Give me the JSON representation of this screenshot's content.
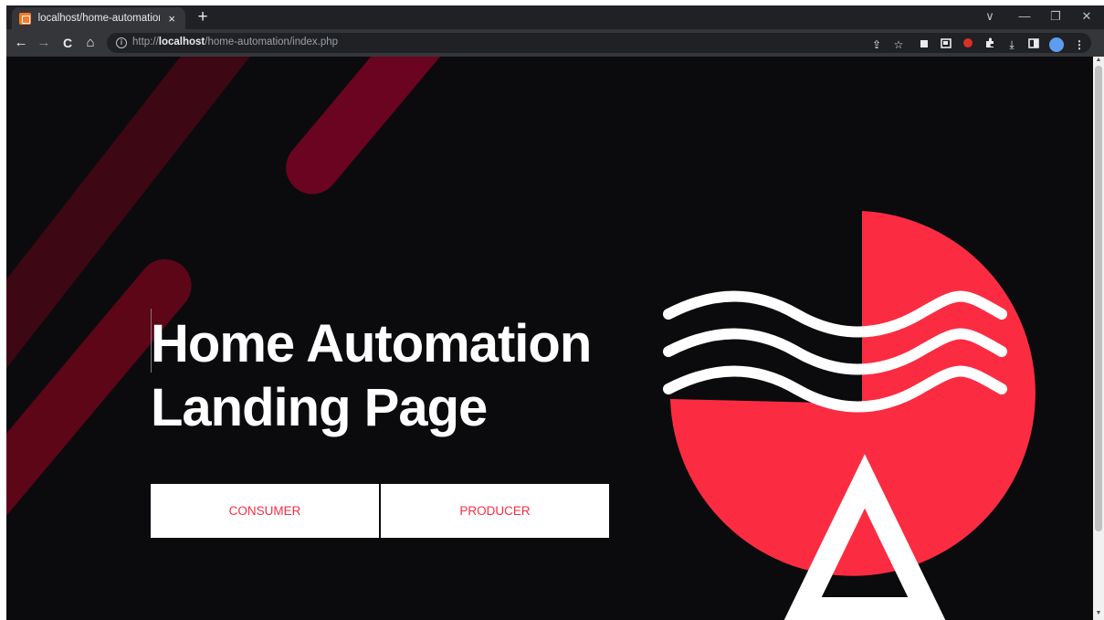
{
  "browser": {
    "tab_title": "localhost/home-automation/index.php",
    "tab_close": "×",
    "new_tab": "+",
    "url_scheme": "http://",
    "url_host": "localhost",
    "url_path": "/home-automation/index.php",
    "info": "i",
    "nav": {
      "back": "←",
      "forward": "→",
      "reload": "C",
      "home": "⌂"
    },
    "window": {
      "menu": "∨",
      "minimize": "—",
      "restore": "❐",
      "close": "✕"
    },
    "toolbar": {
      "share": "⇪",
      "star": "☆",
      "download": "⤓",
      "more": "⋮"
    }
  },
  "hero": {
    "title_line1": "Home Automation",
    "title_line2": "Landing Page",
    "consumer_label": "CONSUMER",
    "producer_label": "PRODUCER"
  },
  "colors": {
    "page_bg": "#0b0b0e",
    "accent_red": "#fb2c41",
    "stripe_dark": "#6b0420",
    "stripe_darker": "#3d0714"
  }
}
